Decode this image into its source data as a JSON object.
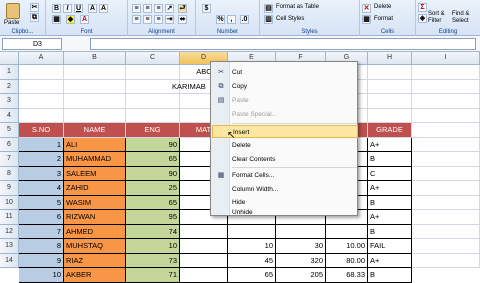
{
  "ribbon": {
    "clipboard": {
      "label": "Clipbo...",
      "paste": "Paste"
    },
    "font": {
      "label": "Font"
    },
    "alignment": {
      "label": "Alignment"
    },
    "number": {
      "label": "Number",
      "currency": "$",
      "percent": "%",
      "comma": ","
    },
    "styles": {
      "label": "Styles",
      "format_as_table": "Format as Table",
      "cell_styles": "Cell Styles"
    },
    "cells": {
      "label": "Cells",
      "delete": "Delete",
      "format": "Format"
    },
    "editing": {
      "label": "Editing",
      "sort": "Sort &",
      "filter": "Filter",
      "find": "Find &",
      "select": "Select"
    }
  },
  "namebox": {
    "value": "D3"
  },
  "columns": [
    "A",
    "B",
    "C",
    "D",
    "E",
    "F",
    "G",
    "H",
    "I"
  ],
  "rows": [
    "1",
    "2",
    "3",
    "4",
    "5",
    "6",
    "7",
    "8",
    "9",
    "10",
    "11",
    "12",
    "13",
    "14"
  ],
  "title1": "ABC",
  "title2": "KARIMAB",
  "table": {
    "headers": {
      "sno": "S.NO",
      "name": "NAME",
      "eng": "ENG",
      "mat": "MAT",
      "grade": "GRADE"
    },
    "rows": [
      {
        "sno": "1",
        "name": "ALI",
        "eng": "90",
        "g": "",
        "grade": "A+"
      },
      {
        "sno": "2",
        "name": "MUHAMMAD",
        "eng": "65",
        "g": "",
        "grade": "B"
      },
      {
        "sno": "3",
        "name": "SALEEM",
        "eng": "90",
        "g": "",
        "grade": "C"
      },
      {
        "sno": "4",
        "name": "ZAHID",
        "eng": "25",
        "g": "",
        "grade": "A+"
      },
      {
        "sno": "5",
        "name": "WASIM",
        "eng": "65",
        "g": "",
        "grade": "B"
      },
      {
        "sno": "6",
        "name": "RIZWAN",
        "eng": "95",
        "g": "",
        "grade": "A+"
      },
      {
        "sno": "7",
        "name": "AHMED",
        "eng": "74",
        "g": "",
        "grade": "B"
      },
      {
        "sno": "8",
        "name": "MUHSTAQ",
        "eng": "10",
        "e": "10",
        "f": "30",
        "g": "10.00",
        "grade": "FAIL"
      },
      {
        "sno": "9",
        "name": "RIAZ",
        "eng": "73",
        "e": "45",
        "f": "320",
        "g": "80.00",
        "grade": "A+"
      },
      {
        "sno": "10",
        "name": "AKBER",
        "eng": "71",
        "e": "65",
        "f": "205",
        "g": "68.33",
        "grade": "B"
      }
    ]
  },
  "context_menu": {
    "cut": "Cut",
    "copy": "Copy",
    "paste": "Paste",
    "paste_special": "Paste Special...",
    "insert": "Insert",
    "delete": "Delete",
    "clear_contents": "Clear Contents",
    "format_cells": "Format Cells...",
    "column_width": "Column Width...",
    "hide": "Hide",
    "unhide": "Unhide"
  },
  "colors": {
    "header_red": "#c0504d",
    "name_orange": "#f79646",
    "sno_blue": "#b8cce4",
    "eng_green": "#c4d79b",
    "highlight": "#fbe6a2"
  }
}
